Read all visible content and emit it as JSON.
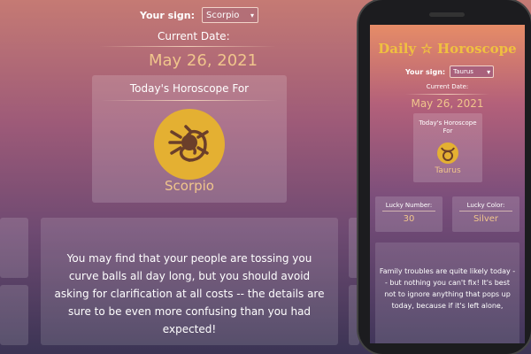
{
  "desktop": {
    "sign_label": "Your sign:",
    "sign_value": "Scorpio",
    "current_date_label": "Current Date:",
    "date": "May 26, 2021",
    "card_title": "Today's Horoscope For",
    "sign_name": "Scorpio",
    "horoscope": "You may find that your people are tossing you curve balls all day long, but you should avoid asking for clarification at all costs -- the details are sure to be even more confusing than you had expected!"
  },
  "phone": {
    "title": "Daily ☆ Horoscope",
    "sign_label": "Your sign:",
    "sign_value": "Taurus",
    "current_date_label": "Current Date:",
    "date": "May 26, 2021",
    "card_title": "Today's Horoscope For",
    "sign_name": "Taurus",
    "lucky_number_label": "Lucky Number:",
    "lucky_number": "30",
    "lucky_color_label": "Lucky Color:",
    "lucky_color": "Silver",
    "horoscope": "Family troubles are quite likely today -- but nothing you can't fix! It's best not to ignore anything that pops up today, because if it's left alone,"
  },
  "colors": {
    "accent_gold": "#f0c58c",
    "icon_gold": "#e4b032"
  },
  "icons": [
    "scorpio-icon",
    "taurus-icon",
    "dropdown-caret-icon"
  ]
}
